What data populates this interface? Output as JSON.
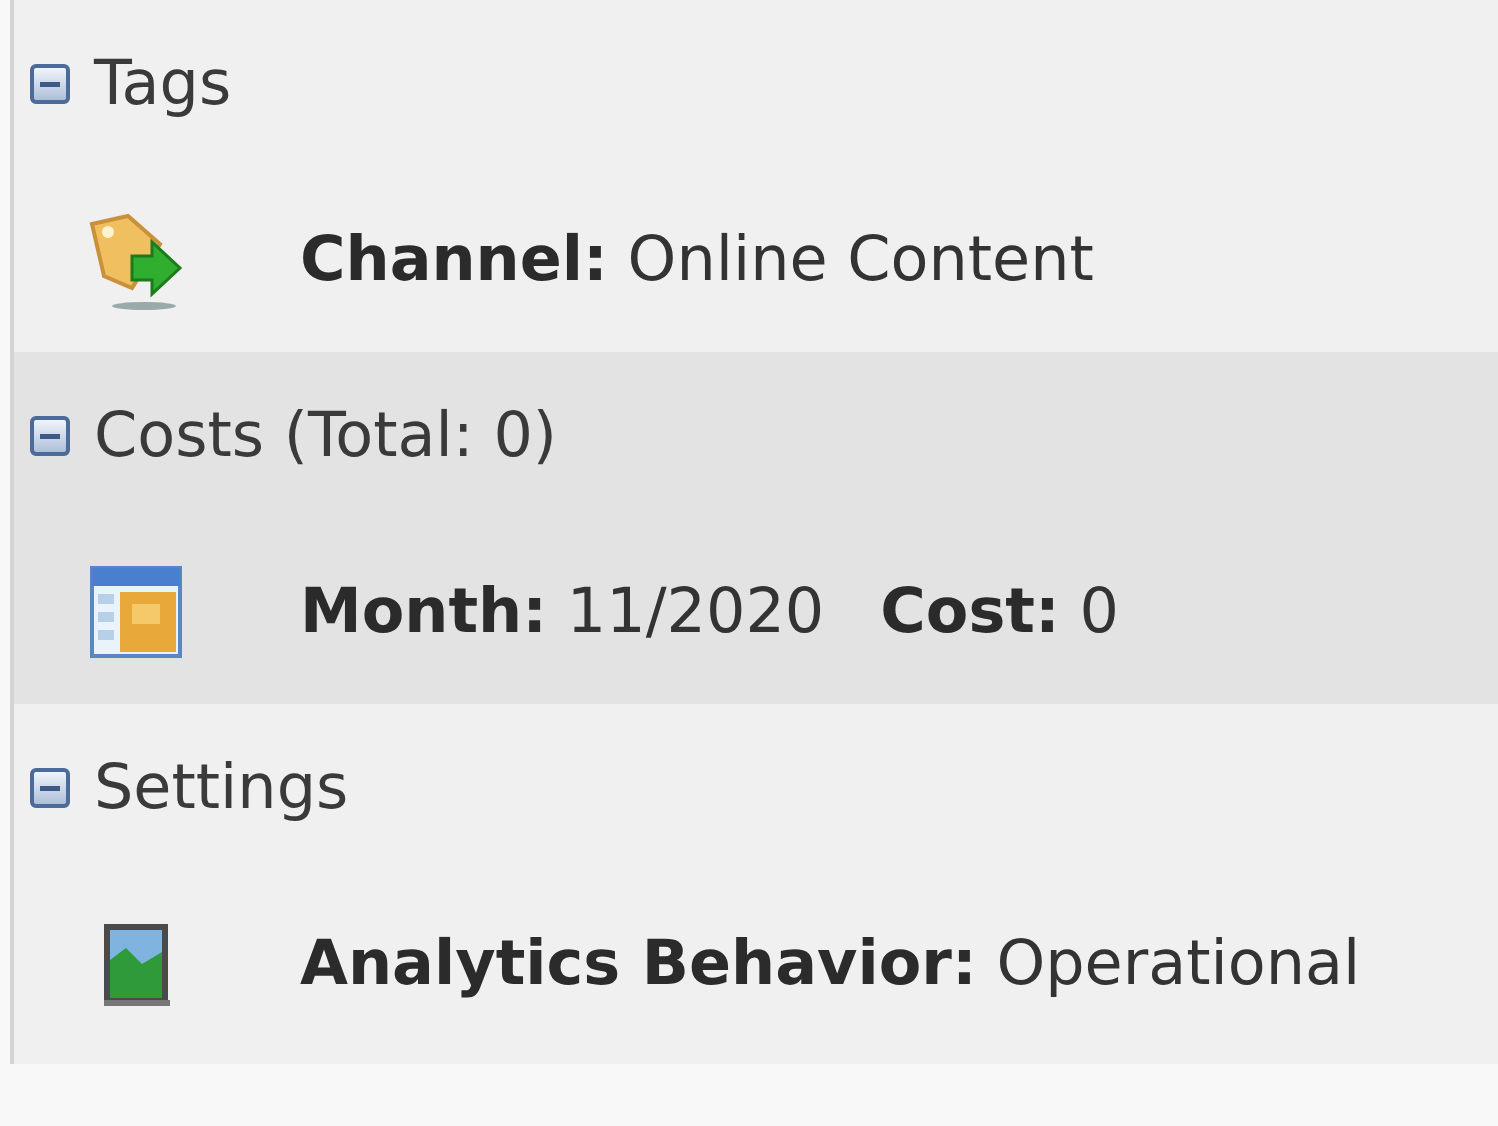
{
  "sections": [
    {
      "title": "Tags",
      "expanded": true,
      "selected": false,
      "items": [
        {
          "kind": "tag",
          "texts": [
            "**Channel:** Online Content"
          ]
        }
      ]
    },
    {
      "title": "Costs (Total: 0)",
      "expanded": true,
      "selected": true,
      "items": [
        {
          "kind": "calendar",
          "texts": [
            "**Month:** 11/2020",
            "**Cost:** 0"
          ]
        }
      ]
    },
    {
      "title": "Settings",
      "expanded": true,
      "selected": false,
      "items": [
        {
          "kind": "image",
          "texts": [
            "**Analytics Behavior:** Operational"
          ]
        }
      ]
    }
  ]
}
